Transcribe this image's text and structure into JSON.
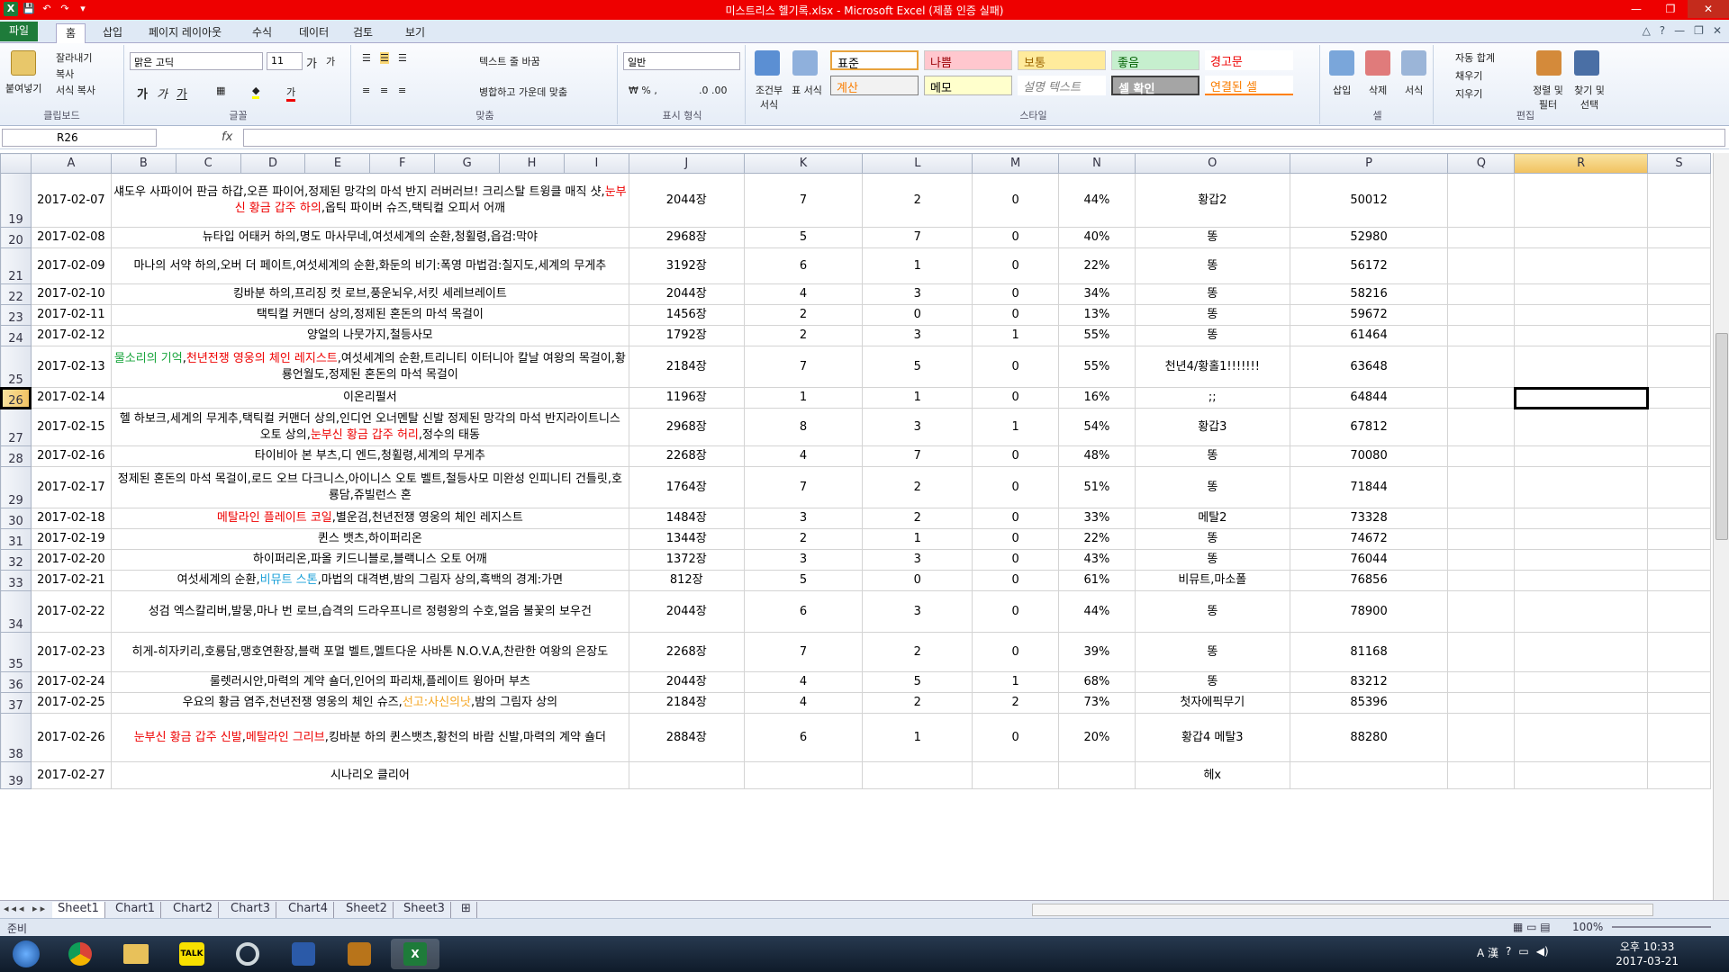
{
  "window": {
    "title": "미스트리스 헬기록.xlsx  -  Microsoft Excel (제품 인증 실패)",
    "min": "—",
    "max": "❐",
    "close": "✕"
  },
  "quick_access": {
    "excel": "X",
    "save": "💾",
    "undo": "↶",
    "redo": "↷",
    "more": "▾"
  },
  "tabs": [
    "파일",
    "홈",
    "삽입",
    "페이지 레이아웃",
    "수식",
    "데이터",
    "검토",
    "보기"
  ],
  "ribbon": {
    "clipboard": {
      "paste": "붙여넣기",
      "cut": "잘라내기",
      "copy": "복사",
      "format_painter": "서식 복사",
      "label": "클립보드"
    },
    "font": {
      "name": "맑은 고딕",
      "size": "11",
      "bold": "가",
      "italic": "가",
      "underline": "가",
      "grow": "가",
      "shrink": "가",
      "label": "글꼴"
    },
    "alignment": {
      "wrap": "텍스트 줄 바꿈",
      "merge": "병합하고 가운데 맞춤",
      "label": "맞춤"
    },
    "number": {
      "format": "일반",
      "label": "표시 형식"
    },
    "styles": {
      "cond": "조건부 서식",
      "table": "표 서식",
      "s1": "표준",
      "s2": "나쁨",
      "s3": "보통",
      "s4": "좋음",
      "s5": "경고문",
      "s6": "계산",
      "s7": "메모",
      "s8": "설명 텍스트",
      "s9": "셀 확인",
      "s10": "연결된 셀",
      "label": "스타일"
    },
    "cells": {
      "insert": "삽입",
      "delete": "삭제",
      "format": "서식",
      "label": "셀"
    },
    "editing": {
      "autosum": "자동 합계",
      "fill": "채우기",
      "clear": "지우기",
      "sort": "정렬 및 필터",
      "find": "찾기 및 선택",
      "label": "편집"
    }
  },
  "namebox": "R26",
  "fx": "fx",
  "columns": [
    "A",
    "B",
    "C",
    "D",
    "E",
    "F",
    "G",
    "H",
    "I",
    "J",
    "K",
    "L",
    "M",
    "N",
    "O",
    "P",
    "Q",
    "R",
    "S"
  ],
  "rows": [
    {
      "n": "19",
      "date": "2017-02-07",
      "items": [
        {
          "t": "섀도우 사파이어 판금 하갑,오픈 파이어,정제된 망각의 마석 반지 러버러브! 크리스탈 트윙클 매직 샷,"
        },
        {
          "t": "눈부신 황금 갑주 하의",
          "c": "red"
        },
        {
          "t": ",옵틱 파이버 슈즈,택틱컬 오피서 어깨"
        }
      ],
      "j": "2044장",
      "k": "7",
      "l": "2",
      "m": "0",
      "n2": "44%",
      "o": "황갑2",
      "p": "50012"
    },
    {
      "n": "20",
      "date": "2017-02-08",
      "items": [
        {
          "t": "뉴타입 어태커 하의,명도 마사무네,여섯세계의 순환,청휠령,읍검:막야"
        }
      ],
      "j": "2968장",
      "k": "5",
      "l": "7",
      "m": "0",
      "n2": "40%",
      "o": "똥",
      "p": "52980"
    },
    {
      "n": "21",
      "date": "2017-02-09",
      "items": [
        {
          "t": "마나의 서약 하의,오버 더 페이트,여섯세계의 순환,화둔의 비기:폭영 마법검:칠지도,세계의 무게추"
        }
      ],
      "j": "3192장",
      "k": "6",
      "l": "1",
      "m": "0",
      "n2": "22%",
      "o": "똥",
      "p": "56172"
    },
    {
      "n": "22",
      "date": "2017-02-10",
      "items": [
        {
          "t": "킹바분 하의,프리징 컷 로브,풍운뇌우,서킷 세레브레이트"
        }
      ],
      "j": "2044장",
      "k": "4",
      "l": "3",
      "m": "0",
      "n2": "34%",
      "o": "똥",
      "p": "58216"
    },
    {
      "n": "23",
      "date": "2017-02-11",
      "items": [
        {
          "t": "택틱컬 커맨더 상의,정제된 혼돈의 마석 목걸이"
        }
      ],
      "j": "1456장",
      "k": "2",
      "l": "0",
      "m": "0",
      "n2": "13%",
      "o": "똥",
      "p": "59672"
    },
    {
      "n": "24",
      "date": "2017-02-12",
      "items": [
        {
          "t": "양얼의 나뭇가지,철등사모"
        }
      ],
      "j": "1792장",
      "k": "2",
      "l": "3",
      "m": "1",
      "n2": "55%",
      "o": "똥",
      "p": "61464"
    },
    {
      "n": "25",
      "date": "2017-02-13",
      "items": [
        {
          "t": "물소리의 기억",
          "c": "green"
        },
        {
          "t": ","
        },
        {
          "t": "천년전쟁 영웅의 체인 레지스트",
          "c": "red"
        },
        {
          "t": ",여섯세계의 순환,트리니티 이터니아 칼날 여왕의 목걸이,황룡언월도,정제된 혼돈의 마석 목걸이"
        }
      ],
      "j": "2184장",
      "k": "7",
      "l": "5",
      "m": "0",
      "n2": "55%",
      "o": "천년4/황홀1!!!!!!!",
      "p": "63648"
    },
    {
      "n": "26",
      "date": "2017-02-14",
      "items": [
        {
          "t": "이온리펄서"
        }
      ],
      "j": "1196장",
      "k": "1",
      "l": "1",
      "m": "0",
      "n2": "16%",
      "o": ";;",
      "p": "64844"
    },
    {
      "n": "27",
      "date": "2017-02-15",
      "items": [
        {
          "t": "헬 하보크,세계의 무게추,택틱컬 커맨더 상의,인디언 오너멘탈 신발 정제된 망각의 마석 반지라이트니스 오토 상의,"
        },
        {
          "t": "눈부신 황금 갑주 허리",
          "c": "red"
        },
        {
          "t": ",정수의 태동"
        }
      ],
      "j": "2968장",
      "k": "8",
      "l": "3",
      "m": "1",
      "n2": "54%",
      "o": "황갑3",
      "p": "67812"
    },
    {
      "n": "28",
      "date": "2017-02-16",
      "items": [
        {
          "t": "타이비아 본 부츠,디 엔드,청휠령,세계의 무게추"
        }
      ],
      "j": "2268장",
      "k": "4",
      "l": "7",
      "m": "0",
      "n2": "48%",
      "o": "똥",
      "p": "70080"
    },
    {
      "n": "29",
      "date": "2017-02-17",
      "items": [
        {
          "t": "정제된 혼돈의 마석 목걸이,로드 오브 다크니스,아이니스 오토 벨트,철등사모 미완성 인피니티 건틀릿,호룡담,쥬빌런스 혼"
        }
      ],
      "j": "1764장",
      "k": "7",
      "l": "2",
      "m": "0",
      "n2": "51%",
      "o": "똥",
      "p": "71844"
    },
    {
      "n": "30",
      "date": "2017-02-18",
      "items": [
        {
          "t": "메탈라인 플레이트 코일",
          "c": "red"
        },
        {
          "t": ",별운검,천년전쟁 영웅의 체인 레지스트"
        }
      ],
      "j": "1484장",
      "k": "3",
      "l": "2",
      "m": "0",
      "n2": "33%",
      "o": "메탈2",
      "p": "73328"
    },
    {
      "n": "31",
      "date": "2017-02-19",
      "items": [
        {
          "t": "퀸스 뱃츠,하이퍼리온"
        }
      ],
      "j": "1344장",
      "k": "2",
      "l": "1",
      "m": "0",
      "n2": "22%",
      "o": "똥",
      "p": "74672"
    },
    {
      "n": "32",
      "date": "2017-02-20",
      "items": [
        {
          "t": "하이퍼리온,파올 키드니블로,블랙니스 오토 어깨"
        }
      ],
      "j": "1372장",
      "k": "3",
      "l": "3",
      "m": "0",
      "n2": "43%",
      "o": "똥",
      "p": "76044"
    },
    {
      "n": "33",
      "date": "2017-02-21",
      "items": [
        {
          "t": "여섯세계의 순환,"
        },
        {
          "t": "비뮤트 스톤",
          "c": "cyan"
        },
        {
          "t": ",마법의 대격변,밤의 그림자 상의,흑백의 경계:가면"
        }
      ],
      "j": "812장",
      "k": "5",
      "l": "0",
      "m": "0",
      "n2": "61%",
      "o": "비뮤트,마소폴",
      "p": "76856"
    },
    {
      "n": "34",
      "date": "2017-02-22",
      "items": [
        {
          "t": "성검 엑스칼리버,발뭉,마나 번 로브,습격의 드라우프니르 정령왕의 수호,얼음 불꽃의 보우건"
        }
      ],
      "j": "2044장",
      "k": "6",
      "l": "3",
      "m": "0",
      "n2": "44%",
      "o": "똥",
      "p": "78900"
    },
    {
      "n": "35",
      "date": "2017-02-23",
      "items": [
        {
          "t": "히게-히자키리,호룡담,맹호연환장,블랙 포멀 벨트,멜트다운 사바톤 N.O.V.A,찬란한 여왕의 은장도"
        }
      ],
      "j": "2268장",
      "k": "7",
      "l": "2",
      "m": "0",
      "n2": "39%",
      "o": "똥",
      "p": "81168"
    },
    {
      "n": "36",
      "date": "2017-02-24",
      "items": [
        {
          "t": "룰렛러시안,마력의 계약 숄더,인어의 파리채,플레이트 윙아머 부츠"
        }
      ],
      "j": "2044장",
      "k": "4",
      "l": "5",
      "m": "1",
      "n2": "68%",
      "o": "똥",
      "p": "83212"
    },
    {
      "n": "37",
      "date": "2017-02-25",
      "items": [
        {
          "t": "우요의 황금 염주,천년전쟁 영웅의 체인 슈즈,"
        },
        {
          "t": "선고:사신의낫",
          "c": "orange"
        },
        {
          "t": ",밤의 그림자 상의"
        }
      ],
      "j": "2184장",
      "k": "4",
      "l": "2",
      "m": "2",
      "n2": "73%",
      "o": "첫자에픽무기",
      "p": "85396"
    },
    {
      "n": "38",
      "date": "2017-02-26",
      "items": [
        {
          "t": "눈부신 황금 갑주 신발",
          "c": "red"
        },
        {
          "t": ","
        },
        {
          "t": "메탈라인 그리브",
          "c": "red"
        },
        {
          "t": ",킹바분 하의 퀸스뱃츠,황천의 바람 신발,마력의 계약 숄더"
        }
      ],
      "j": "2884장",
      "k": "6",
      "l": "1",
      "m": "0",
      "n2": "20%",
      "o": "황갑4 메탈3",
      "p": "88280"
    },
    {
      "n": "39",
      "date": "2017-02-27",
      "items": [
        {
          "t": "시나리오 클리어"
        }
      ],
      "j": "",
      "k": "",
      "l": "",
      "m": "",
      "n2": "",
      "o": "헤x",
      "p": ""
    }
  ],
  "sheets": [
    "Sheet1",
    "Chart1",
    "Chart2",
    "Chart3",
    "Chart4",
    "Sheet2",
    "Sheet3"
  ],
  "status": {
    "ready": "준비",
    "zoom": "100%"
  },
  "clock": {
    "time": "오후 10:33",
    "date": "2017-03-21"
  },
  "tray": {
    "ime": "A 漢"
  }
}
